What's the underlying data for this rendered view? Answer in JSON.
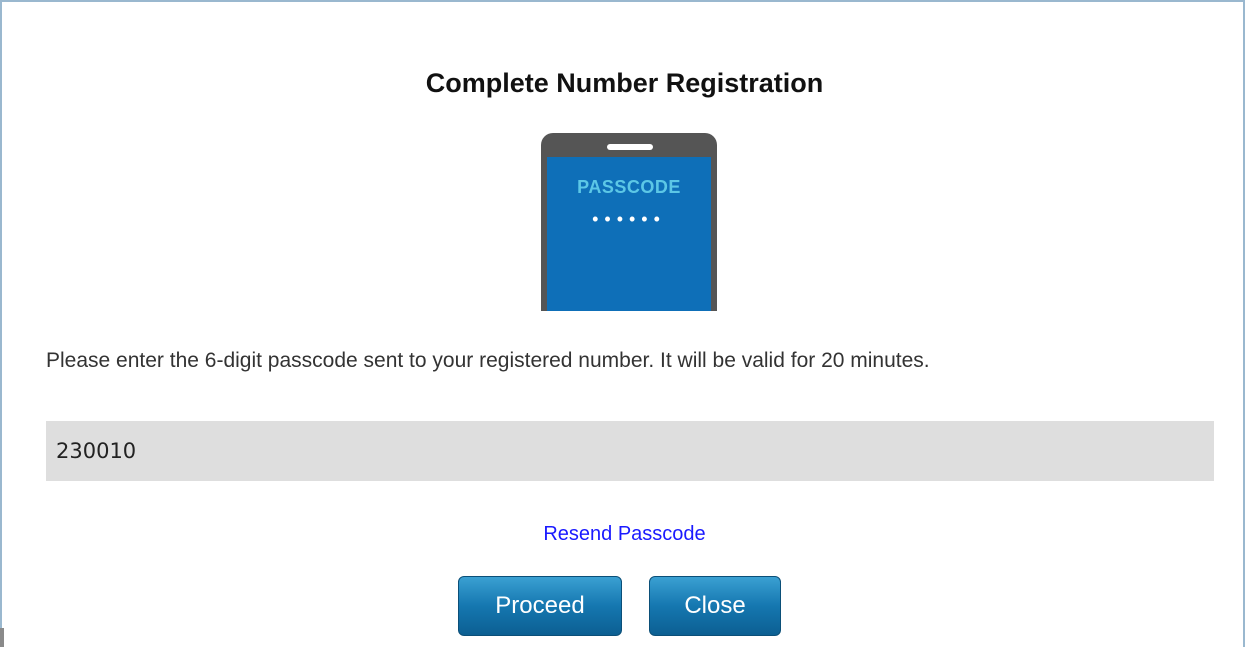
{
  "dialog": {
    "title": "Complete Number Registration",
    "illustration": {
      "icon": "phone-passcode-icon",
      "screen_label": "PASSCODE",
      "masked_dots": "••••••",
      "colors": {
        "body": "#555555",
        "screen": "#0e6fb8",
        "label": "#5cc7e6"
      }
    },
    "instructions": "Please enter the 6-digit passcode sent to your registered number. It will be valid for 20 minutes.",
    "passcode_input": {
      "value": "230010",
      "placeholder": ""
    },
    "resend_label": "Resend Passcode",
    "buttons": {
      "proceed_label": "Proceed",
      "close_label": "Close"
    },
    "colors": {
      "link": "#1a1aff",
      "button": "#1577b0",
      "input_background": "#dedede"
    }
  }
}
